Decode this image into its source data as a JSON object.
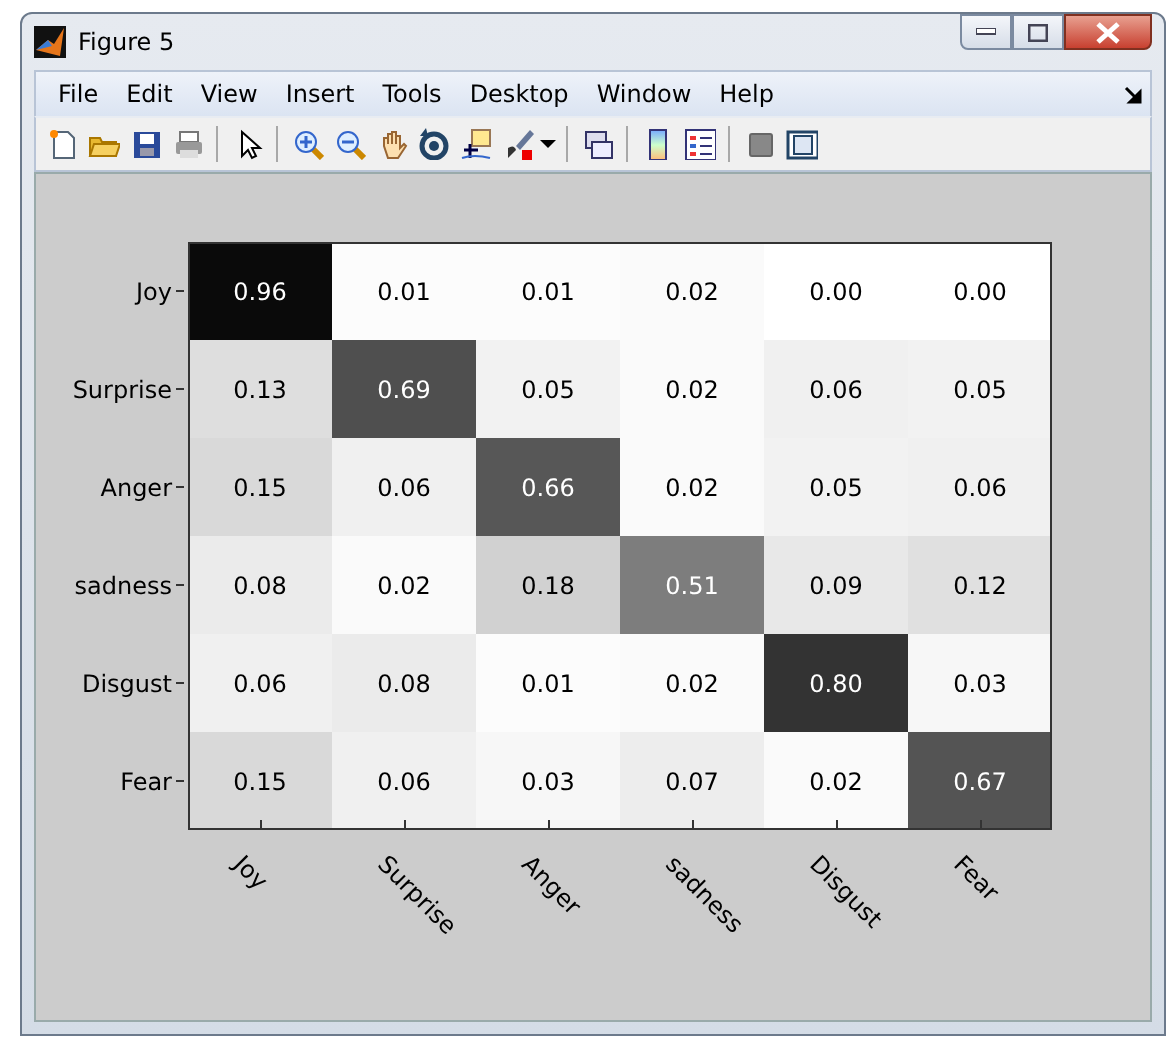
{
  "window": {
    "title": "Figure 5"
  },
  "menu": [
    "File",
    "Edit",
    "View",
    "Insert",
    "Tools",
    "Desktop",
    "Window",
    "Help"
  ],
  "matrix": {
    "row_labels": [
      "Joy",
      "Surprise",
      "Anger",
      "sadness",
      "Disgust",
      "Fear"
    ],
    "column_labels": [
      "Joy",
      "Surprise",
      "Anger",
      "sadness",
      "Disgust",
      "Fear"
    ],
    "rows": [
      [
        {
          "value": "0.96",
          "color": "#0a0a0a"
        },
        {
          "value": "0.01",
          "color": "#fcfcfc"
        },
        {
          "value": "0.01",
          "color": "#fcfcfc"
        },
        {
          "value": "0.02",
          "color": "#fafafa"
        },
        {
          "value": "0.00",
          "color": "#ffffff"
        },
        {
          "value": "0.00",
          "color": "#ffffff"
        }
      ],
      [
        {
          "value": "0.13",
          "color": "#dedede"
        },
        {
          "value": "0.69",
          "color": "#4f4f4f"
        },
        {
          "value": "0.05",
          "color": "#f2f2f2"
        },
        {
          "value": "0.02",
          "color": "#fafafa"
        },
        {
          "value": "0.06",
          "color": "#f0f0f0"
        },
        {
          "value": "0.05",
          "color": "#f2f2f2"
        }
      ],
      [
        {
          "value": "0.15",
          "color": "#d9d9d9"
        },
        {
          "value": "0.06",
          "color": "#f0f0f0"
        },
        {
          "value": "0.66",
          "color": "#575757"
        },
        {
          "value": "0.02",
          "color": "#fafafa"
        },
        {
          "value": "0.05",
          "color": "#f2f2f2"
        },
        {
          "value": "0.06",
          "color": "#f0f0f0"
        }
      ],
      [
        {
          "value": "0.08",
          "color": "#ebebeb"
        },
        {
          "value": "0.02",
          "color": "#fafafa"
        },
        {
          "value": "0.18",
          "color": "#d1d1d1"
        },
        {
          "value": "0.51",
          "color": "#7d7d7d"
        },
        {
          "value": "0.09",
          "color": "#e8e8e8"
        },
        {
          "value": "0.12",
          "color": "#e0e0e0"
        }
      ],
      [
        {
          "value": "0.06",
          "color": "#f0f0f0"
        },
        {
          "value": "0.08",
          "color": "#ebebeb"
        },
        {
          "value": "0.01",
          "color": "#fcfcfc"
        },
        {
          "value": "0.02",
          "color": "#fafafa"
        },
        {
          "value": "0.80",
          "color": "#333333"
        },
        {
          "value": "0.03",
          "color": "#f7f7f7"
        }
      ],
      [
        {
          "value": "0.15",
          "color": "#d9d9d9"
        },
        {
          "value": "0.06",
          "color": "#f0f0f0"
        },
        {
          "value": "0.03",
          "color": "#f7f7f7"
        },
        {
          "value": "0.07",
          "color": "#ededed"
        },
        {
          "value": "0.02",
          "color": "#fafafa"
        },
        {
          "value": "0.67",
          "color": "#545454"
        }
      ]
    ]
  }
}
